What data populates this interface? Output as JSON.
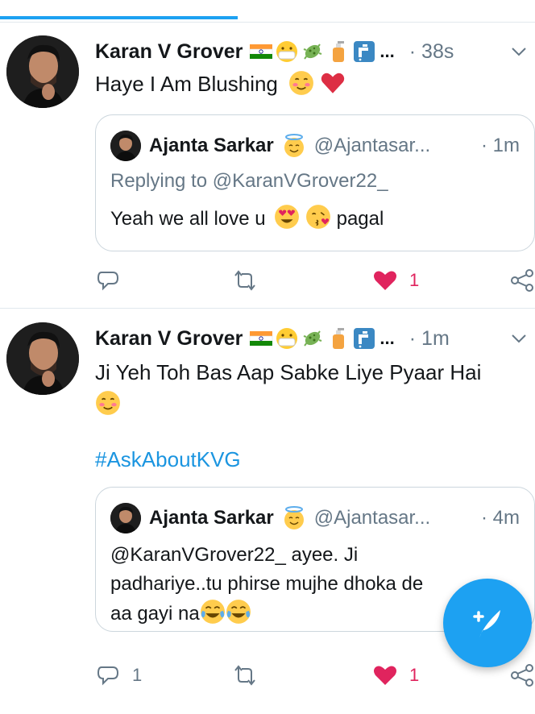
{
  "tabs": {
    "active_index": 0
  },
  "tweets": [
    {
      "author": "Karan V Grover",
      "name_emojis": [
        "india-flag",
        "mask-face",
        "microbe",
        "soap",
        "faucet"
      ],
      "ellipsis": "...",
      "time": "38s",
      "text_lines": [
        "Haye I Am Blushing"
      ],
      "text_emojis": [
        "smiling-face",
        "red-heart"
      ],
      "quote": {
        "author": "Ajanta Sarkar",
        "author_emoji": "halo-face",
        "handle": "@Ajantasar...",
        "time": "1m",
        "replying_to": "Replying to @KaranVGrover22_",
        "text": "Yeah we all love u",
        "text_emojis": [
          "heart-eyes",
          "kissing-heart"
        ],
        "text_end": "pagal"
      },
      "actions": {
        "replies": "",
        "retweets": "",
        "likes": "1",
        "liked": true
      }
    },
    {
      "author": "Karan V Grover",
      "name_emojis": [
        "india-flag",
        "mask-face",
        "microbe",
        "soap",
        "faucet"
      ],
      "ellipsis": "...",
      "time": "1m",
      "text_lines": [
        "Ji Yeh Toh Bas Aap Sabke Liye Pyaar Hai"
      ],
      "text_emojis": [
        "smiling-face"
      ],
      "hashtag": "#AskAboutKVG",
      "quote": {
        "author": "Ajanta Sarkar",
        "author_emoji": "halo-face",
        "handle": "@Ajantasar...",
        "time": "4m",
        "lines": [
          "@KaranVGrover22_ ayee. Ji",
          "padhariye..tu phirse mujhe dhoka de",
          "aa gayi na"
        ],
        "text_emojis": [
          "tears-of-joy",
          "tears-of-joy"
        ]
      },
      "actions": {
        "replies": "1",
        "retweets": "",
        "likes": "1",
        "liked": true
      }
    }
  ],
  "colors": {
    "accent": "#1da1f2",
    "like": "#e0245e",
    "muted": "#657786",
    "hashtag": "#1b95e0"
  }
}
